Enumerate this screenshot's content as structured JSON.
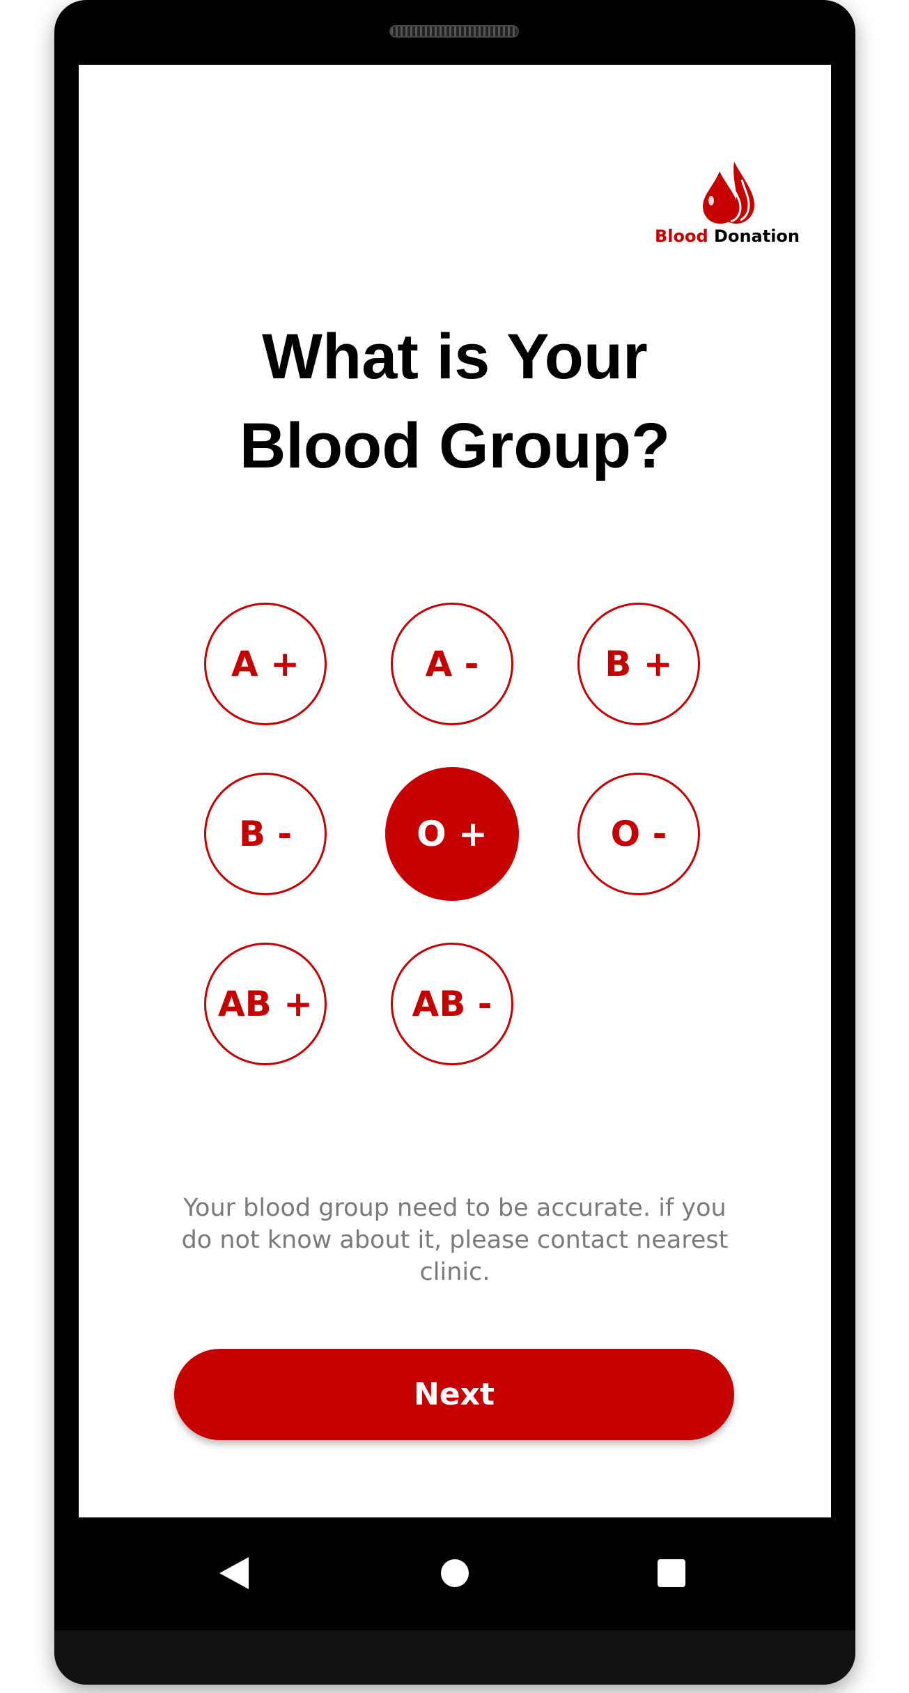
{
  "logo": {
    "word1": "Blood",
    "word2": "Donation",
    "icon": "blood-drops-icon",
    "color_accent": "#c60000"
  },
  "title": {
    "line1": "What is Your",
    "line2": "Blood Group?"
  },
  "blood_groups": [
    {
      "label": "A +",
      "selected": false
    },
    {
      "label": "A -",
      "selected": false
    },
    {
      "label": "B +",
      "selected": false
    },
    {
      "label": "B -",
      "selected": false
    },
    {
      "label": "O +",
      "selected": true
    },
    {
      "label": "O -",
      "selected": false
    },
    {
      "label": "AB +",
      "selected": false
    },
    {
      "label": "AB -",
      "selected": false
    }
  ],
  "info_text": "Your blood group need to be accurate. if you do not know about it, please contact nearest clinic.",
  "next_label": "Next",
  "nav": {
    "back_icon": "back-triangle-icon",
    "home_icon": "home-circle-icon",
    "recents_icon": "recents-square-icon"
  },
  "colors": {
    "primary": "#c60000",
    "text": "#000000",
    "muted": "#7a7a7a"
  }
}
